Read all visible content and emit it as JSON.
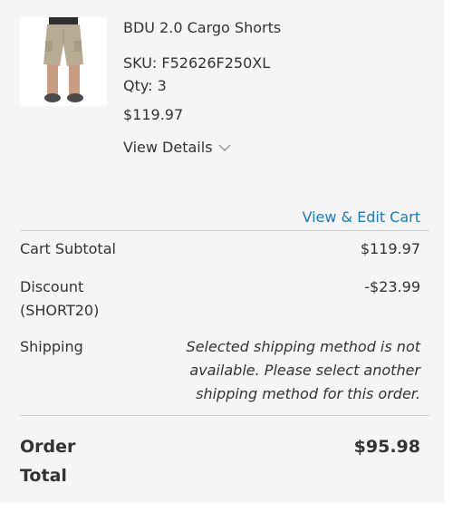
{
  "item": {
    "name": "BDU 2.0 Cargo Shorts",
    "sku": "SKU: F52626F250XL",
    "qty": "Qty: 3",
    "price": "$119.97",
    "view_details_label": "View Details",
    "image_icon": "product-shorts-photo"
  },
  "cart_link": "View & Edit Cart",
  "summary": {
    "subtotal_label": "Cart Subtotal",
    "subtotal_value": "$119.97",
    "discount_label": "Discount (SHORT20)",
    "discount_value": "-$23.99",
    "shipping_label": "Shipping",
    "shipping_message": "Selected shipping method is not available. Please select another shipping method for this order.",
    "total_label": "Order Total",
    "total_value": "$95.98"
  },
  "colors": {
    "panel_bg": "#f5f5f5",
    "link": "#1979c3",
    "text": "#333333",
    "divider": "#cccccc"
  }
}
